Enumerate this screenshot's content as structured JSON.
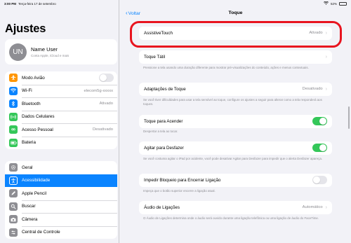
{
  "statusbar": {
    "time": "3:00 PM",
    "date": "Terça-feira 17 de setembro",
    "battery": "52%",
    "battery_level": 0.52
  },
  "sidebar": {
    "title": "Ajustes",
    "profile": {
      "initials": "UN",
      "name": "Name User",
      "subtitle": "Conta Apple, iCloud e mais"
    },
    "group1": [
      {
        "label": "Modo Avião",
        "icon": "airplane-icon",
        "color": "#ff9500",
        "toggle": false
      },
      {
        "label": "Wi-Fi",
        "icon": "wifi-icon",
        "color": "#0a84ff",
        "value": "elecom5g-xxxxx"
      },
      {
        "label": "Bluetooth",
        "icon": "bluetooth-icon",
        "color": "#0a84ff",
        "value": "Ativado"
      },
      {
        "label": "Dados Celulares",
        "icon": "cellular-icon",
        "color": "#34c759",
        "value": ""
      },
      {
        "label": "Acesso Pessoal",
        "icon": "hotspot-icon",
        "color": "#34c759",
        "value": "Desativado"
      },
      {
        "label": "Bateria",
        "icon": "battery-icon",
        "color": "#34c759",
        "value": ""
      }
    ],
    "group2": [
      {
        "label": "Geral",
        "icon": "gear-icon",
        "color": "#8e8e93"
      },
      {
        "label": "Acessibilidade",
        "icon": "accessibility-icon",
        "color": "#0a84ff",
        "selected": true
      },
      {
        "label": "Apple Pencil",
        "icon": "pencil-icon",
        "color": "#8e8e93"
      },
      {
        "label": "Buscar",
        "icon": "search-icon",
        "color": "#8e8e93"
      },
      {
        "label": "Câmera",
        "icon": "camera-icon",
        "color": "#8e8e93"
      },
      {
        "label": "Central de Controle",
        "icon": "control-center-icon",
        "color": "#8e8e93"
      }
    ]
  },
  "main": {
    "back_label": "Voltar",
    "title": "Toque",
    "assistive_touch": {
      "label": "AssistiveTouch",
      "value": "Ativado"
    },
    "toque_tatil": {
      "label": "Toque Tátil"
    },
    "toque_tatil_desc": "Pressione a tela usando uma duração diferente para mostrar pré-visualizações do conteúdo, ações e menus contextuais.",
    "adaptacoes": {
      "label": "Adaptações de Toque",
      "value": "Desativado"
    },
    "adaptacoes_desc": "Se você tiver dificuldades para usar a tela sensível ao toque, configure os ajustes a seguir para alterar como a tela responderá aos toques.",
    "toque_acender": {
      "label": "Toque para Acender",
      "on": true
    },
    "toque_acender_desc": "Despertar a tela ao tocar.",
    "agitar": {
      "label": "Agitar para Desfazer",
      "on": true
    },
    "agitar_desc": "Se você costuma agitar o iPad por acidente, você pode desativar Agitar para Desfazer para impedir que o alerta Desfazer apareça.",
    "impedir": {
      "label": "Impedir Bloqueio para Encerrar Ligação",
      "on": false
    },
    "impedir_desc": "Impeça que o botão superior encerre a ligação atual.",
    "audio": {
      "label": "Áudio de Ligações",
      "value": "Automático"
    },
    "audio_desc": "O Áudio de Ligações determina onde o áudio será ouvido durante uma ligação telefônica ou uma ligação de áudio do FaceTime."
  }
}
